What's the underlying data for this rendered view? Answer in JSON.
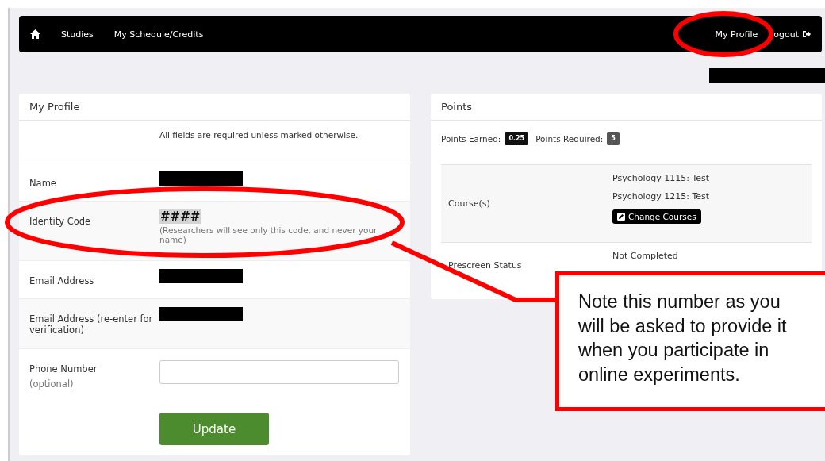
{
  "nav": {
    "left": [
      {
        "label": "Studies"
      },
      {
        "label": "My Schedule/Credits"
      }
    ],
    "right": [
      {
        "label": "My Profile",
        "kind": "link"
      },
      {
        "label": "ogout",
        "kind": "logout"
      }
    ]
  },
  "profile": {
    "title": "My Profile",
    "notice": "All fields are required unless marked otherwise.",
    "fields": [
      {
        "label": "Name",
        "kind": "redacted"
      },
      {
        "label": "Identity Code",
        "kind": "code",
        "value": "####",
        "hint": "(Researchers will see only this code, and never your name)"
      },
      {
        "label": "Email Address",
        "kind": "redacted"
      },
      {
        "label": "Email Address (re-enter for verification)",
        "kind": "redacted"
      },
      {
        "label": "Phone Number",
        "sublabel": "(optional)",
        "kind": "input"
      }
    ],
    "button": "Update"
  },
  "points": {
    "title": "Points",
    "earned_label": "Points Earned:",
    "earned": "0.25",
    "required_label": "Points Required:",
    "required": "5",
    "rows": [
      {
        "label": "Course(s)",
        "kind": "courses",
        "courses": [
          "Psychology 1115: Test",
          "Psychology 1215: Test"
        ],
        "button": "Change Courses"
      },
      {
        "label": "Prescreen Status",
        "kind": "text",
        "value": "Not Completed"
      }
    ]
  },
  "callout": "Note this number as you will be asked to provide it when you participate in online experiments."
}
